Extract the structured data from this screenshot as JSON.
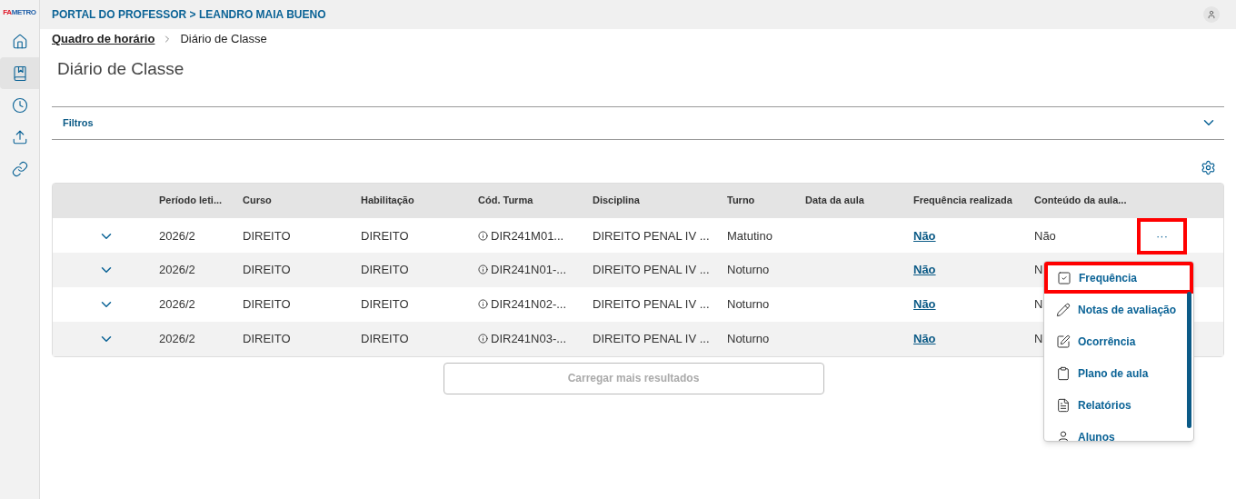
{
  "logo": {
    "text_a": "FA",
    "text_b": "METRO"
  },
  "sidebar": {
    "items": [
      {
        "kind": "home",
        "selected": false
      },
      {
        "kind": "book",
        "selected": true
      },
      {
        "kind": "clock",
        "selected": false
      },
      {
        "kind": "upload",
        "selected": false
      },
      {
        "kind": "link",
        "selected": false
      }
    ]
  },
  "top_bar": {
    "title": "PORTAL DO PROFESSOR > LEANDRO MAIA BUENO"
  },
  "breadcrumb": [
    {
      "label": "Quadro de horário",
      "kind": "link"
    },
    {
      "label": "Diário de Classe",
      "kind": "current"
    }
  ],
  "page_title": "Diário de Classe",
  "filters": {
    "label": "Filtros",
    "expanded": false
  },
  "table": {
    "columns": [
      "Período leti...",
      "Curso",
      "Habilitação",
      "Cód. Turma",
      "Disciplina",
      "Turno",
      "Data da aula",
      "Frequência realizada",
      "Conteúdo da aula..."
    ],
    "rows": [
      {
        "periodo": "2026/2",
        "curso": "DIREITO",
        "habilitacao": "DIREITO",
        "turma": "DIR241M01...",
        "disciplina": "DIREITO PENAL IV ...",
        "turno": "Matutino",
        "frequencia": "Não",
        "conteudo": "Não",
        "actions": "···",
        "highlighted": true
      },
      {
        "periodo": "2026/2",
        "curso": "DIREITO",
        "habilitacao": "DIREITO",
        "turma": "DIR241N01-...",
        "disciplina": "DIREITO PENAL IV ...",
        "turno": "Noturno",
        "frequencia": "Não",
        "conteudo": "N"
      },
      {
        "periodo": "2026/2",
        "curso": "DIREITO",
        "habilitacao": "DIREITO",
        "turma": "DIR241N02-...",
        "disciplina": "DIREITO PENAL IV ...",
        "turno": "Noturno",
        "frequencia": "Não",
        "conteudo": "N"
      },
      {
        "periodo": "2026/2",
        "curso": "DIREITO",
        "habilitacao": "DIREITO",
        "turma": "DIR241N03-...",
        "disciplina": "DIREITO PENAL IV ...",
        "turno": "Noturno",
        "frequencia": "Não",
        "conteudo": "N"
      }
    ]
  },
  "load_more": {
    "label": "Carregar mais resultados",
    "disabled": true
  },
  "menu": {
    "items": [
      {
        "kind": "check",
        "label": "Frequência",
        "highlighted": true
      },
      {
        "kind": "pencil",
        "label": "Notas de avaliação",
        "highlighted": false
      },
      {
        "kind": "edit",
        "label": "Ocorrência",
        "highlighted": false
      },
      {
        "kind": "clipboard",
        "label": "Plano de aula",
        "highlighted": false
      },
      {
        "kind": "pdf",
        "label": "Relatórios",
        "highlighted": false
      },
      {
        "kind": "user",
        "label": "Alunos",
        "highlighted": false
      }
    ]
  }
}
